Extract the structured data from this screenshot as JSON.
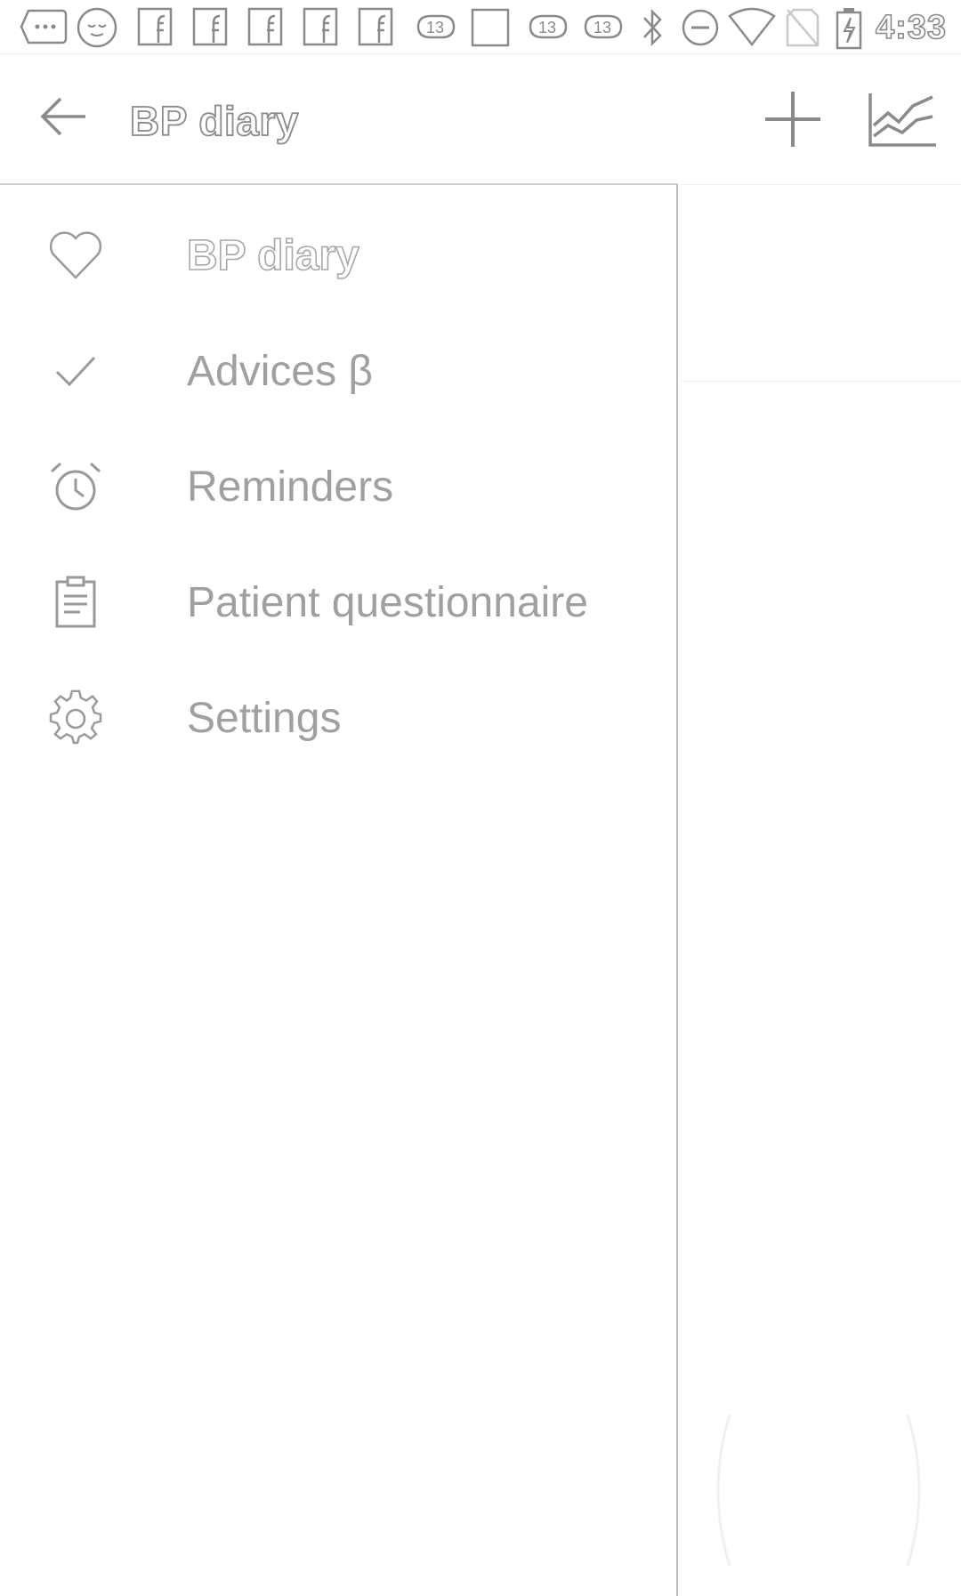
{
  "status_bar": {
    "time": "4:33",
    "icons": [
      "chat-icon",
      "emoji-icon",
      "facebook-icon",
      "facebook-icon",
      "facebook-icon",
      "facebook-icon",
      "facebook-icon",
      "game-13-icon",
      "square-icon",
      "game-13-icon",
      "game-13-icon",
      "bluetooth-icon",
      "do-not-disturb-icon",
      "wifi-icon",
      "no-sim-icon",
      "battery-charging-icon"
    ]
  },
  "app_bar": {
    "title": "BP diary",
    "back_icon": "arrow-back-icon",
    "add_icon": "plus-icon",
    "chart_icon": "chart-icon"
  },
  "drawer": {
    "items": [
      {
        "label": "BP diary",
        "icon": "heart-icon",
        "active": true
      },
      {
        "label": "Advices β",
        "icon": "check-icon",
        "active": false
      },
      {
        "label": "Reminders",
        "icon": "alarm-clock-icon",
        "active": false
      },
      {
        "label": "Patient questionnaire",
        "icon": "clipboard-icon",
        "active": false
      },
      {
        "label": "Settings",
        "icon": "gear-icon",
        "active": false
      }
    ]
  },
  "colors": {
    "icon_stroke": "#8a8a8a",
    "label": "#a0a0a0",
    "divider": "#bdbdbd",
    "background": "#ffffff"
  }
}
